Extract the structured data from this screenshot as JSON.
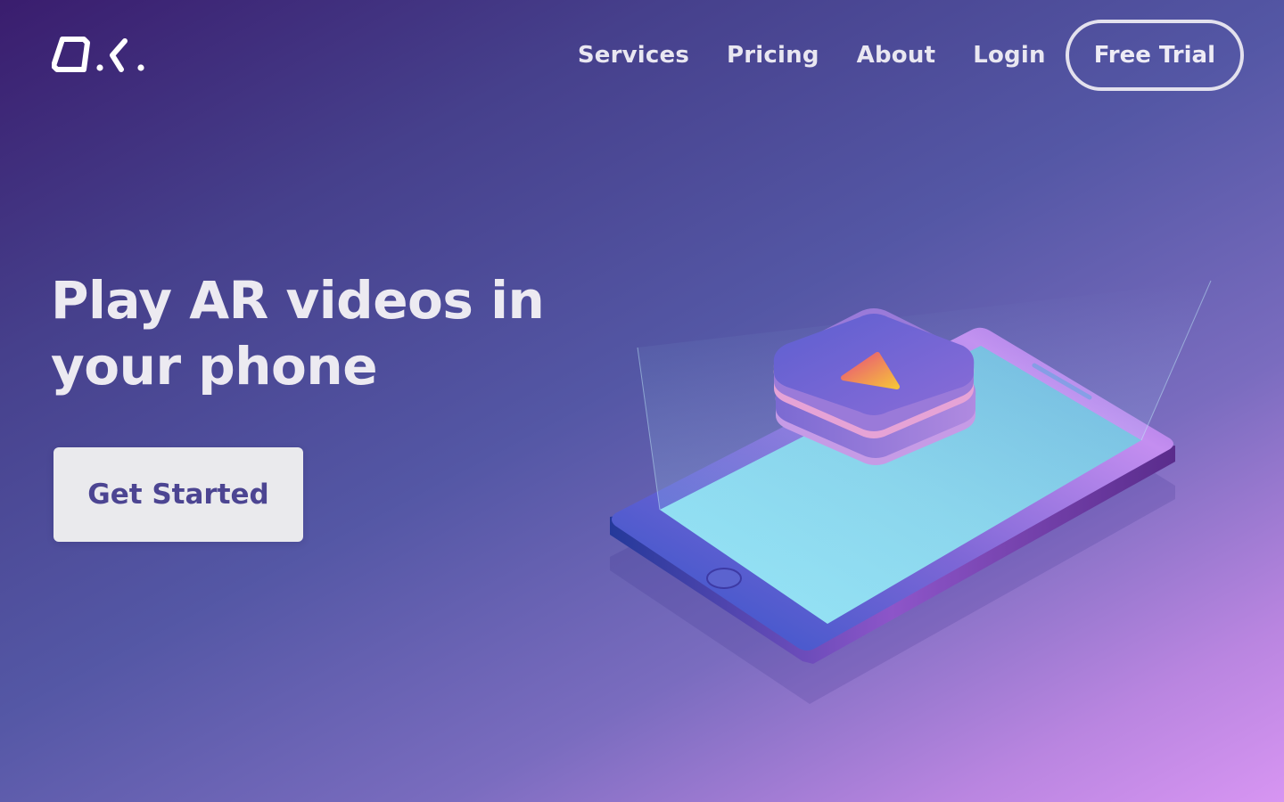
{
  "brand": {
    "logo_text": "O.K."
  },
  "nav": {
    "items": [
      {
        "label": "Services"
      },
      {
        "label": "Pricing"
      },
      {
        "label": "About"
      },
      {
        "label": "Login"
      }
    ],
    "trial_label": "Free Trial"
  },
  "hero": {
    "title": "Play AR videos in your phone",
    "cta_label": "Get Started"
  },
  "icons": {
    "illustration": "phone-ar-hologram-icon",
    "play": "play-icon"
  },
  "colors": {
    "background_start": "#3a1d6e",
    "background_end": "#d795f2",
    "text": "#eceaf1",
    "cta_background": "#eaeaed",
    "cta_text": "#4c4592"
  }
}
